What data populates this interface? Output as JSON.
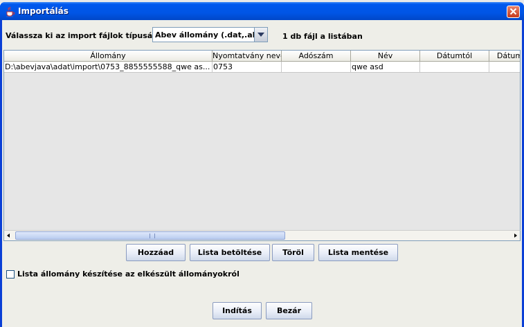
{
  "window": {
    "title": "Importálás"
  },
  "filetype": {
    "label": "Válassza ki az import fájlok típusát :",
    "selected": "Abev állomány (.dat,.abv)"
  },
  "file_count": "1 db fájl a listában",
  "table": {
    "columns": [
      "Állomány",
      "Nyomtatvány neve",
      "Adószám",
      "Név",
      "Dátumtól",
      "Dátum"
    ],
    "rows": [
      [
        "D:\\abevjava\\adat\\import\\0753_8855555588_qwe as...",
        "0753",
        "",
        "qwe asd",
        "",
        ""
      ]
    ]
  },
  "list_buttons": {
    "add": "Hozzáad",
    "load": "Lista betöltése",
    "delete": "Töröl",
    "save": "Lista mentése"
  },
  "create_list_checkbox": {
    "label": "Lista állomány készítése az elkészült állományokról",
    "checked": false
  },
  "action_buttons": {
    "start": "Indítás",
    "close": "Bezár"
  },
  "colors": {
    "titlebar": "#0055e5",
    "dialog_bg": "#eeeee8",
    "border": "#7f9db9"
  },
  "icons": {
    "title": "java-cup-icon",
    "close": "close-icon",
    "dropdown": "chevron-down-icon"
  }
}
